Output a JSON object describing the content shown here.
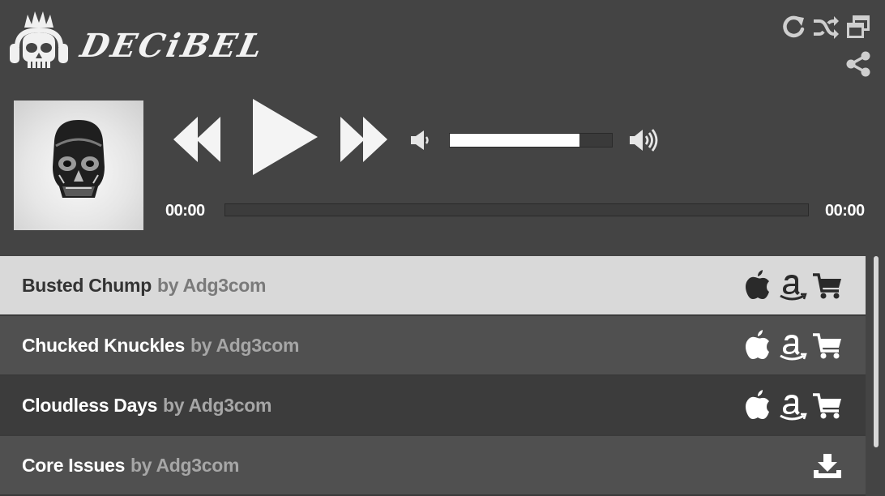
{
  "app": {
    "name": "DECiBEL"
  },
  "player": {
    "elapsed": "00:00",
    "duration": "00:00",
    "volume": 0.8,
    "progress": 0,
    "state": "paused"
  },
  "playlist": [
    {
      "title": "Busted Chump",
      "by": "by Adg3com",
      "active": true,
      "actions": [
        "apple-icon",
        "amazon-icon",
        "cart-icon"
      ]
    },
    {
      "title": "Chucked Knuckles",
      "by": "by Adg3com",
      "active": false,
      "actions": [
        "apple-icon",
        "amazon-icon",
        "cart-icon"
      ]
    },
    {
      "title": "Cloudless Days",
      "by": "by Adg3com",
      "active": false,
      "actions": [
        "apple-icon",
        "amazon-icon",
        "cart-icon"
      ]
    },
    {
      "title": "Core Issues",
      "by": "by Adg3com",
      "active": false,
      "actions": [
        "download-icon"
      ]
    }
  ],
  "colors": {
    "background": "#444444",
    "row_active": "#d9d9d9",
    "row_a": "#505050",
    "row_b": "#3c3c3c",
    "title_active": "#333333",
    "title": "#ffffff",
    "by_active": "#7a7a7a",
    "by": "#a6a6a6"
  }
}
